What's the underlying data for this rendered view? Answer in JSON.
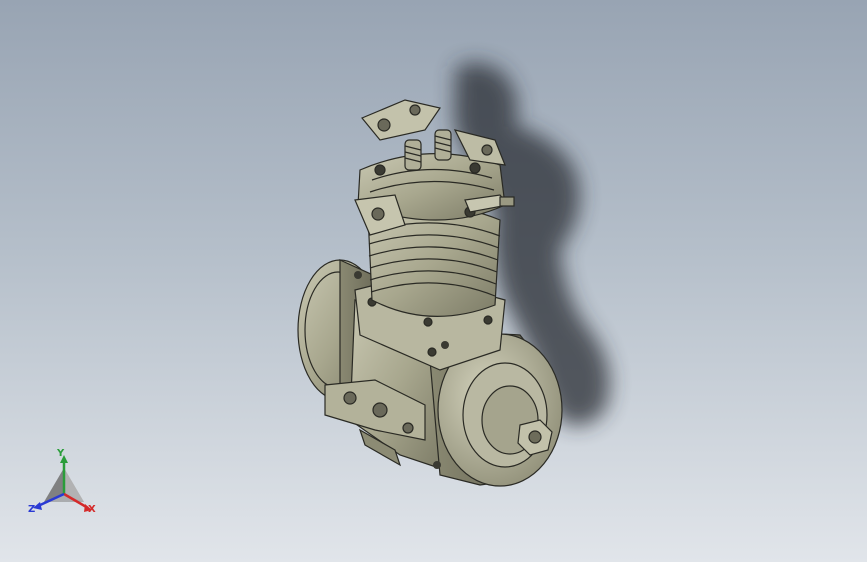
{
  "viewport": {
    "background_top": "#98a4b3",
    "background_bottom": "#e1e5ea",
    "model_color": "#a8a78e",
    "edge_color": "#2a2a24"
  },
  "triad": {
    "x_label": "X",
    "y_label": "Y",
    "z_label": "Z",
    "x_color": "#d42a2a",
    "y_color": "#2a9d3a",
    "z_color": "#2a3ad4"
  }
}
